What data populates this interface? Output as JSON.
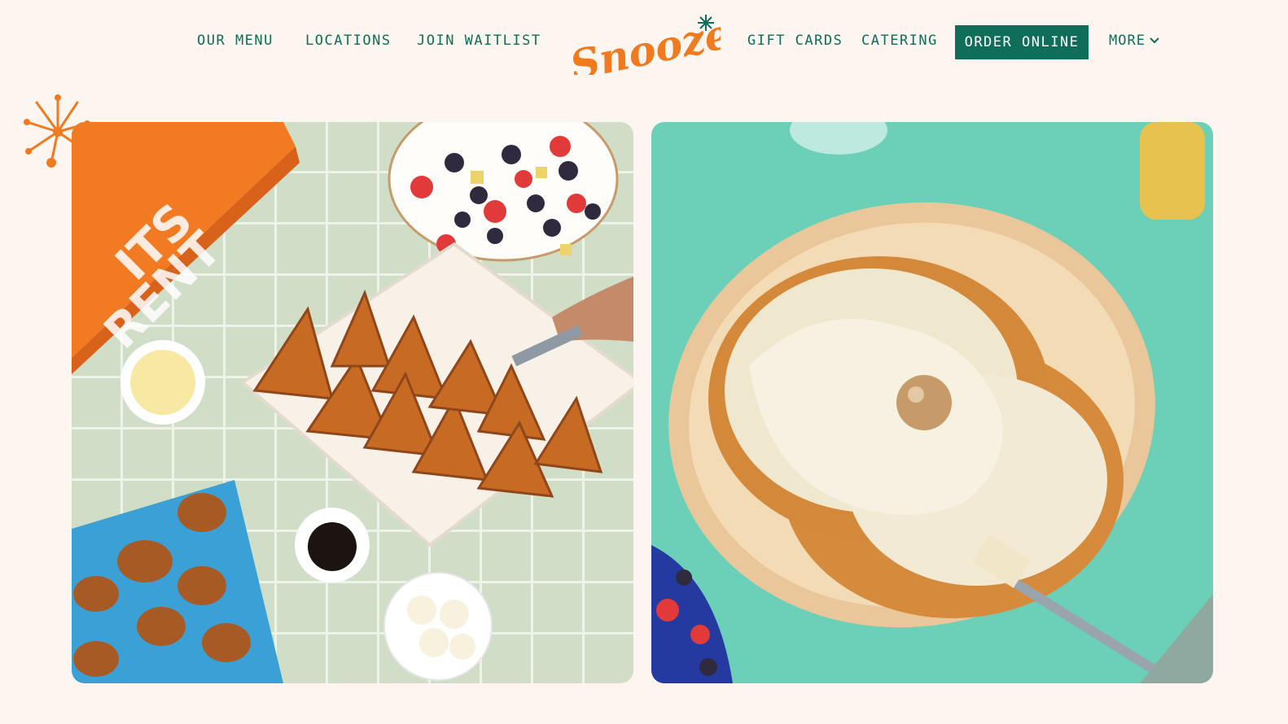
{
  "brand": {
    "name": "Snooze",
    "logo_color": "#f07a1f",
    "accent_green": "#0f6e5a",
    "background": "#fdf6f0"
  },
  "nav": {
    "left_links": [
      "OUR MENU",
      "LOCATIONS",
      "JOIN WAITLIST"
    ],
    "right_links": [
      "GIFT CARDS",
      "CATERING"
    ],
    "order_button": "ORDER ONLINE",
    "more_label": "MORE",
    "more_icon": "chevron-down-icon"
  },
  "hero": {
    "left_image": "catering spread with french toast, fruit bowl and pretzel sliders",
    "left_box_text": "ITS\nRENT",
    "right_image": "pancakes with cream topping on a plate"
  }
}
